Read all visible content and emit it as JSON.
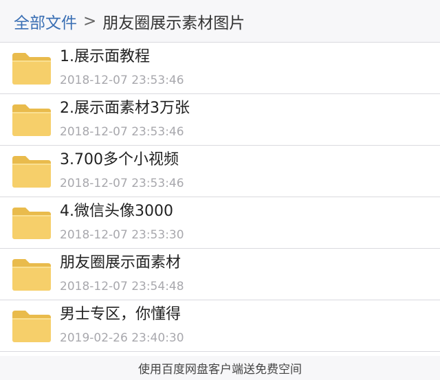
{
  "breadcrumb": {
    "root": "全部文件",
    "separator": ">",
    "current": "朋友圈展示素材图片"
  },
  "files": [
    {
      "name": "1.展示面教程",
      "time": "2018-12-07 23:53:46",
      "icon": "folder-icon"
    },
    {
      "name": "2.展示面素材3万张",
      "time": "2018-12-07 23:53:46",
      "icon": "folder-icon"
    },
    {
      "name": "3.700多个小视频",
      "time": "2018-12-07 23:53:46",
      "icon": "folder-icon"
    },
    {
      "name": "4.微信头像3000",
      "time": "2018-12-07 23:53:30",
      "icon": "folder-icon"
    },
    {
      "name": "朋友圈展示面素材",
      "time": "2018-12-07 23:54:48",
      "icon": "folder-icon"
    },
    {
      "name": "男士专区，你懂得",
      "time": "2019-02-26 23:40:30",
      "icon": "folder-icon"
    }
  ],
  "footer": {
    "text": "使用百度网盘客户端送免费空间"
  },
  "colors": {
    "folder": "#f6cf6a",
    "folder_dark": "#e9bb4c",
    "link": "#3a6fb4"
  }
}
